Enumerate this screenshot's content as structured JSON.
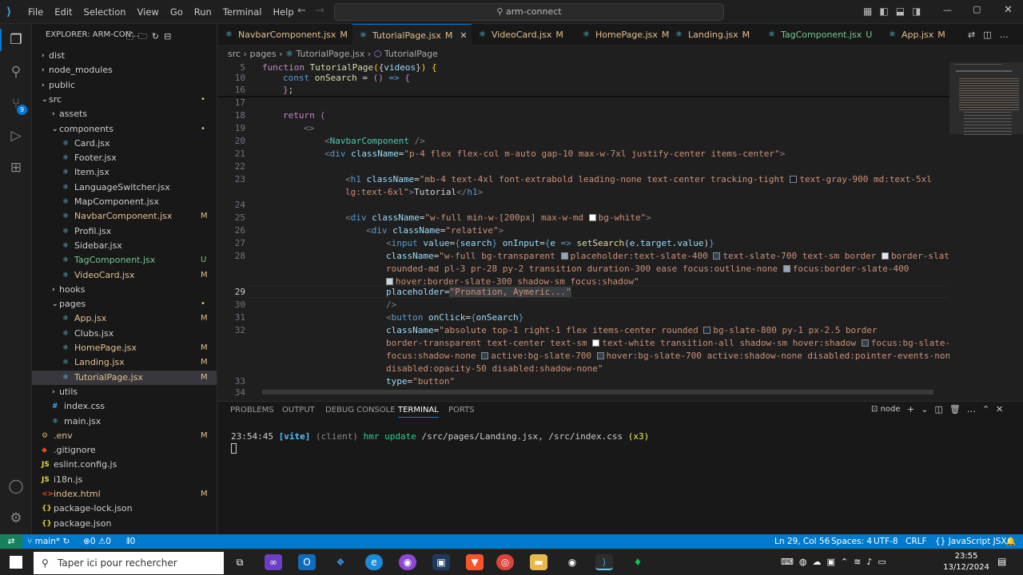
{
  "menu": [
    "File",
    "Edit",
    "Selection",
    "View",
    "Go",
    "Run",
    "Terminal",
    "Help"
  ],
  "search": "arm-connect",
  "explorer_title": "EXPLORER: ARM-CON...",
  "tree": [
    {
      "label": "dist",
      "indent": 1,
      "type": "folder-closed",
      "mark": ""
    },
    {
      "label": "node_modules",
      "indent": 1,
      "type": "folder-closed",
      "mark": ""
    },
    {
      "label": "public",
      "indent": 1,
      "type": "folder-closed",
      "mark": ""
    },
    {
      "label": "src",
      "indent": 1,
      "type": "folder-open",
      "mark": "•"
    },
    {
      "label": "assets",
      "indent": 2,
      "type": "folder-closed",
      "mark": ""
    },
    {
      "label": "components",
      "indent": 2,
      "type": "folder-open",
      "mark": "•"
    },
    {
      "label": "Card.jsx",
      "indent": 3,
      "type": "jsx",
      "mark": ""
    },
    {
      "label": "Footer.jsx",
      "indent": 3,
      "type": "jsx",
      "mark": ""
    },
    {
      "label": "Item.jsx",
      "indent": 3,
      "type": "jsx",
      "mark": ""
    },
    {
      "label": "LanguageSwitcher.jsx",
      "indent": 3,
      "type": "jsx",
      "mark": ""
    },
    {
      "label": "MapComponent.jsx",
      "indent": 3,
      "type": "jsx",
      "mark": ""
    },
    {
      "label": "NavbarComponent.jsx",
      "indent": 3,
      "type": "jsx",
      "mark": "M"
    },
    {
      "label": "Profil.jsx",
      "indent": 3,
      "type": "jsx",
      "mark": ""
    },
    {
      "label": "Sidebar.jsx",
      "indent": 3,
      "type": "jsx",
      "mark": ""
    },
    {
      "label": "TagComponent.jsx",
      "indent": 3,
      "type": "jsx",
      "mark": "U"
    },
    {
      "label": "VideoCard.jsx",
      "indent": 3,
      "type": "jsx",
      "mark": "M"
    },
    {
      "label": "hooks",
      "indent": 2,
      "type": "folder-closed",
      "mark": ""
    },
    {
      "label": "pages",
      "indent": 2,
      "type": "folder-open",
      "mark": "•"
    },
    {
      "label": "App.jsx",
      "indent": 3,
      "type": "jsx",
      "mark": "M"
    },
    {
      "label": "Clubs.jsx",
      "indent": 3,
      "type": "jsx",
      "mark": ""
    },
    {
      "label": "HomePage.jsx",
      "indent": 3,
      "type": "jsx",
      "mark": "M"
    },
    {
      "label": "Landing.jsx",
      "indent": 3,
      "type": "jsx",
      "mark": "M"
    },
    {
      "label": "TutorialPage.jsx",
      "indent": 3,
      "type": "jsx",
      "mark": "M",
      "selected": true
    },
    {
      "label": "utils",
      "indent": 2,
      "type": "folder-closed",
      "mark": ""
    },
    {
      "label": "index.css",
      "indent": 2,
      "type": "css",
      "mark": ""
    },
    {
      "label": "main.jsx",
      "indent": 2,
      "type": "jsx",
      "mark": ""
    },
    {
      "label": ".env",
      "indent": 1,
      "type": "env",
      "mark": "M"
    },
    {
      "label": ".gitignore",
      "indent": 1,
      "type": "git",
      "mark": ""
    },
    {
      "label": "eslint.config.js",
      "indent": 1,
      "type": "js",
      "mark": ""
    },
    {
      "label": "i18n.js",
      "indent": 1,
      "type": "js",
      "mark": ""
    },
    {
      "label": "index.html",
      "indent": 1,
      "type": "html",
      "mark": "M"
    },
    {
      "label": "package-lock.json",
      "indent": 1,
      "type": "json",
      "mark": ""
    },
    {
      "label": "package.json",
      "indent": 1,
      "type": "json",
      "mark": ""
    }
  ],
  "tabs": [
    {
      "label": "NavbarComponent.jsx",
      "mark": "M"
    },
    {
      "label": "TutorialPage.jsx",
      "mark": "M",
      "active": true
    },
    {
      "label": "VideoCard.jsx",
      "mark": "M"
    },
    {
      "label": "HomePage.jsx",
      "mark": "M"
    },
    {
      "label": "Landing.jsx",
      "mark": "M"
    },
    {
      "label": "TagComponent.jsx",
      "mark": "U"
    },
    {
      "label": "App.jsx",
      "mark": "M"
    }
  ],
  "breadcrumb": [
    "src",
    "pages",
    "TutorialPage.jsx",
    "TutorialPage"
  ],
  "panel_tabs": [
    "PROBLEMS",
    "OUTPUT",
    "DEBUG CONSOLE",
    "TERMINAL",
    "PORTS"
  ],
  "terminal": {
    "time": "23:54:45",
    "tag": "[vite]",
    "client": "(client)",
    "msg": "hmr update",
    "paths": "/src/pages/Landing.jsx, /src/index.css",
    "count": "(x3)",
    "shell": "node"
  },
  "status": {
    "branch": "main*",
    "errors": "0",
    "warnings": "0",
    "ports": "0",
    "position": "Ln 29, Col 56",
    "spaces": "Spaces: 4",
    "encoding": "UTF-8",
    "eol": "CRLF",
    "language": "JavaScript JSX"
  },
  "taskbar": {
    "search_placeholder": "Taper ici pour rechercher",
    "time": "23:55",
    "date": "13/12/2024"
  },
  "colors": {
    "statusbar": "#007acc",
    "accent": "#0078d4",
    "modified": "#e2c08d",
    "untracked": "#73c991"
  }
}
